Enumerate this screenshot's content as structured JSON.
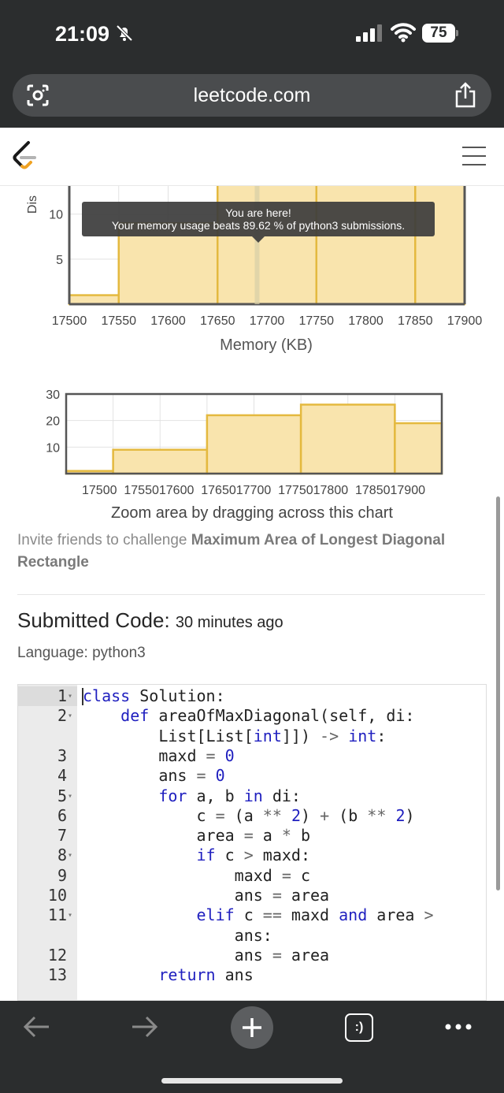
{
  "status_bar": {
    "time": "21:09",
    "battery": "75"
  },
  "browser": {
    "url": "leetcode.com"
  },
  "main_chart": {
    "axis_clip_text": "Dis",
    "y_ticks": [
      "10",
      "5"
    ],
    "x_ticks": [
      "17500",
      "17550",
      "17600",
      "17650",
      "17700",
      "17750",
      "17800",
      "17850",
      "17900"
    ],
    "xlabel": "Memory (KB)",
    "tooltip_line1": "You are here!",
    "tooltip_line2": "Your memory usage beats 89.62 % of python3 submissions."
  },
  "chart_data": [
    {
      "type": "bar",
      "xlabel": "Memory (KB)",
      "ylabel": "",
      "x_ticks": [
        17500,
        17550,
        17600,
        17650,
        17700,
        17750,
        17800,
        17850,
        17900
      ],
      "bins": [
        [
          17500,
          17550
        ],
        [
          17550,
          17650
        ],
        [
          17650,
          17750
        ],
        [
          17750,
          17850
        ],
        [
          17850,
          17900
        ]
      ],
      "values": [
        1,
        9,
        22,
        26,
        19
      ],
      "ylim": [
        0,
        14
      ],
      "y_ticks": [
        5,
        10
      ],
      "highlight_x": 17690,
      "grid": true
    },
    {
      "type": "bar",
      "xlabel": "",
      "ylabel": "",
      "x_ticks": [
        17500,
        17550,
        17600,
        17650,
        17700,
        17750,
        17800,
        17850,
        17900
      ],
      "bins": [
        [
          17500,
          17550
        ],
        [
          17550,
          17650
        ],
        [
          17650,
          17750
        ],
        [
          17750,
          17850
        ],
        [
          17850,
          17900
        ]
      ],
      "values": [
        1,
        9,
        22,
        26,
        19
      ],
      "ylim": [
        0,
        30
      ],
      "y_ticks": [
        10,
        20,
        30
      ],
      "grid": true
    }
  ],
  "zoom_chart": {
    "y_ticks": [
      "30",
      "20",
      "10"
    ],
    "x_tick_text": "17500  1755017600  1765017700  1775017800  1785017900",
    "hint": "Zoom area by dragging across this chart"
  },
  "invite": {
    "prefix": "Invite friends to challenge ",
    "problem": "Maximum Area of Longest Diagonal Rectangle"
  },
  "submission": {
    "heading": "Submitted Code:",
    "time": "30 minutes ago",
    "language": "Language: python3"
  },
  "code": {
    "gutter": [
      {
        "n": "1",
        "fold": true
      },
      {
        "n": "2",
        "fold": true
      },
      {
        "n": "",
        "fold": false
      },
      {
        "n": "3",
        "fold": false
      },
      {
        "n": "4",
        "fold": false
      },
      {
        "n": "5",
        "fold": true
      },
      {
        "n": "6",
        "fold": false
      },
      {
        "n": "7",
        "fold": false
      },
      {
        "n": "8",
        "fold": true
      },
      {
        "n": "9",
        "fold": false
      },
      {
        "n": "10",
        "fold": false
      },
      {
        "n": "11",
        "fold": true
      },
      {
        "n": "",
        "fold": false
      },
      {
        "n": "12",
        "fold": false
      },
      {
        "n": "13",
        "fold": false
      }
    ],
    "lines": [
      [
        [
          "kw",
          "class"
        ],
        [
          "t",
          " Solution:"
        ]
      ],
      [
        [
          "t",
          "    "
        ],
        [
          "kw",
          "def"
        ],
        [
          "t",
          " areaOfMaxDiagonal(self, di:"
        ]
      ],
      [
        [
          "t",
          "        List[List["
        ],
        [
          "kw",
          "int"
        ],
        [
          "t",
          "]]) "
        ],
        [
          "op",
          "->"
        ],
        [
          "t",
          " "
        ],
        [
          "kw",
          "int"
        ],
        [
          "t",
          ":"
        ]
      ],
      [
        [
          "t",
          "        maxd "
        ],
        [
          "op",
          "="
        ],
        [
          "t",
          " "
        ],
        [
          "num",
          "0"
        ]
      ],
      [
        [
          "t",
          "        ans "
        ],
        [
          "op",
          "="
        ],
        [
          "t",
          " "
        ],
        [
          "num",
          "0"
        ]
      ],
      [
        [
          "t",
          "        "
        ],
        [
          "kw",
          "for"
        ],
        [
          "t",
          " a, b "
        ],
        [
          "kw",
          "in"
        ],
        [
          "t",
          " di:"
        ]
      ],
      [
        [
          "t",
          "            c "
        ],
        [
          "op",
          "="
        ],
        [
          "t",
          " (a "
        ],
        [
          "op",
          "**"
        ],
        [
          "t",
          " "
        ],
        [
          "num",
          "2"
        ],
        [
          "t",
          ") "
        ],
        [
          "op",
          "+"
        ],
        [
          "t",
          " (b "
        ],
        [
          "op",
          "**"
        ],
        [
          "t",
          " "
        ],
        [
          "num",
          "2"
        ],
        [
          "t",
          ")"
        ]
      ],
      [
        [
          "t",
          "            area "
        ],
        [
          "op",
          "="
        ],
        [
          "t",
          " a "
        ],
        [
          "op",
          "*"
        ],
        [
          "t",
          " b"
        ]
      ],
      [
        [
          "t",
          "            "
        ],
        [
          "kw",
          "if"
        ],
        [
          "t",
          " c "
        ],
        [
          "op",
          ">"
        ],
        [
          "t",
          " maxd:"
        ]
      ],
      [
        [
          "t",
          "                maxd "
        ],
        [
          "op",
          "="
        ],
        [
          "t",
          " c"
        ]
      ],
      [
        [
          "t",
          "                ans "
        ],
        [
          "op",
          "="
        ],
        [
          "t",
          " area"
        ]
      ],
      [
        [
          "t",
          "            "
        ],
        [
          "kw",
          "elif"
        ],
        [
          "t",
          " c "
        ],
        [
          "op",
          "=="
        ],
        [
          "t",
          " maxd "
        ],
        [
          "kw",
          "and"
        ],
        [
          "t",
          " area "
        ],
        [
          "op",
          ">"
        ]
      ],
      [
        [
          "t",
          "                ans:"
        ]
      ],
      [
        [
          "t",
          "                ans "
        ],
        [
          "op",
          "="
        ],
        [
          "t",
          " area"
        ]
      ],
      [
        [
          "t",
          "        "
        ],
        [
          "kw",
          "return"
        ],
        [
          "t",
          " ans"
        ]
      ]
    ]
  },
  "bottom_bar": {
    "tab_label": ":)"
  },
  "colors": {
    "bar_fill": "#f9e4ad",
    "bar_stroke": "#e4b93f",
    "chrome": "#2b2d2e"
  }
}
